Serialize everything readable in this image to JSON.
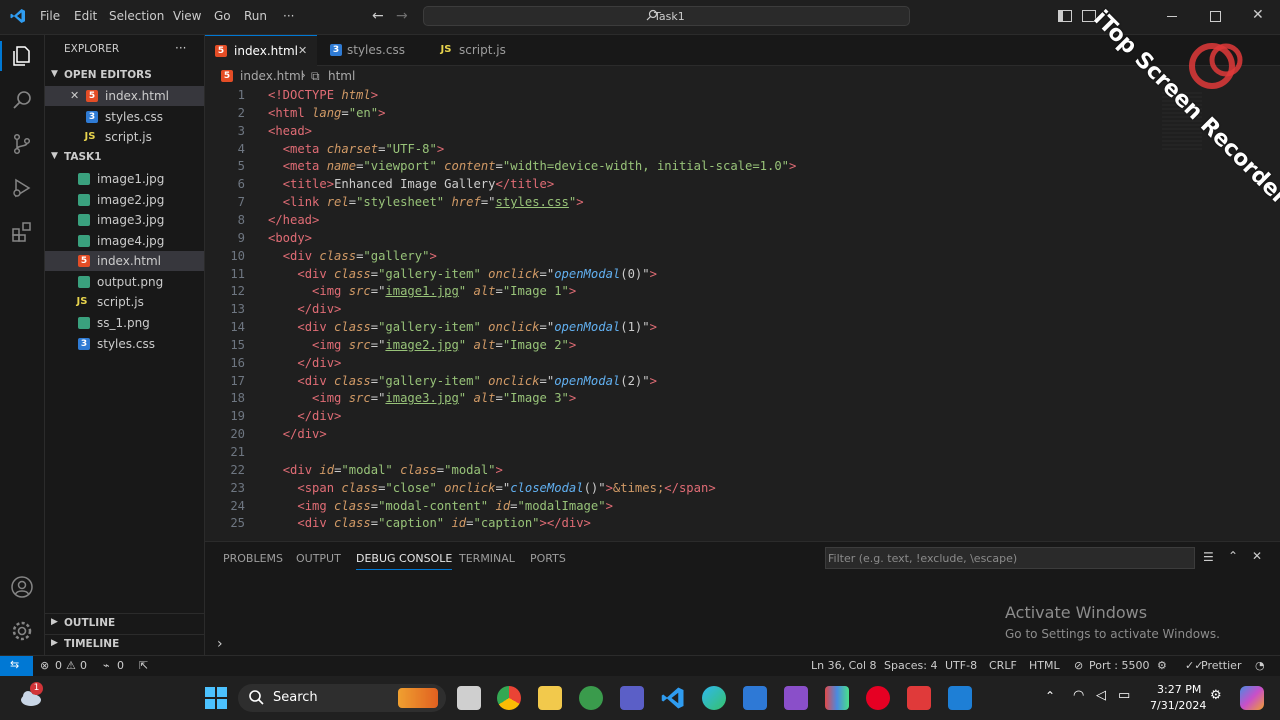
{
  "menu": [
    "File",
    "Edit",
    "Selection",
    "View",
    "Go",
    "Run",
    "···"
  ],
  "search": {
    "text": "Task1"
  },
  "sidebar": {
    "title": "EXPLORER",
    "more": "···",
    "open_editors_label": "OPEN EDITORS",
    "open_editors": [
      {
        "name": "index.html",
        "type": "html",
        "close": "✕"
      },
      {
        "name": "styles.css",
        "type": "css"
      },
      {
        "name": "script.js",
        "type": "js"
      }
    ],
    "folder_label": "TASK1",
    "files": [
      {
        "name": "image1.jpg",
        "type": "img"
      },
      {
        "name": "image2.jpg",
        "type": "img"
      },
      {
        "name": "image3.jpg",
        "type": "img"
      },
      {
        "name": "image4.jpg",
        "type": "img"
      },
      {
        "name": "index.html",
        "type": "html"
      },
      {
        "name": "output.png",
        "type": "img"
      },
      {
        "name": "script.js",
        "type": "js"
      },
      {
        "name": "ss_1.png",
        "type": "img"
      },
      {
        "name": "styles.css",
        "type": "css"
      }
    ],
    "outline_label": "OUTLINE",
    "timeline_label": "TIMELINE"
  },
  "tabs": [
    {
      "name": "index.html",
      "type": "html",
      "close": "✕"
    },
    {
      "name": "styles.css",
      "type": "css"
    },
    {
      "name": "script.js",
      "type": "js"
    }
  ],
  "breadcrumb": {
    "file": "index.html",
    "symbol": "html"
  },
  "code_lines": [
    {
      "n": "1",
      "t": [
        [
          "t-tag",
          "<!DOCTYPE "
        ],
        [
          "t-attr",
          "html"
        ],
        [
          "t-tag",
          ">"
        ]
      ]
    },
    {
      "n": "2",
      "t": [
        [
          "t-tag",
          "<html "
        ],
        [
          "t-attr",
          "lang"
        ],
        [
          "t-punct",
          "="
        ],
        [
          "t-str",
          "\"en\""
        ],
        [
          "t-tag",
          ">"
        ]
      ]
    },
    {
      "n": "3",
      "t": [
        [
          "t-tag",
          "<head>"
        ]
      ]
    },
    {
      "n": "4",
      "t": [
        [
          "t-punct",
          "  "
        ],
        [
          "t-tag",
          "<meta "
        ],
        [
          "t-attr",
          "charset"
        ],
        [
          "t-punct",
          "="
        ],
        [
          "t-str",
          "\"UTF-8\""
        ],
        [
          "t-tag",
          ">"
        ]
      ]
    },
    {
      "n": "5",
      "t": [
        [
          "t-punct",
          "  "
        ],
        [
          "t-tag",
          "<meta "
        ],
        [
          "t-attr",
          "name"
        ],
        [
          "t-punct",
          "="
        ],
        [
          "t-str",
          "\"viewport\" "
        ],
        [
          "t-attr",
          "content"
        ],
        [
          "t-punct",
          "="
        ],
        [
          "t-str",
          "\"width=device-width, initial-scale=1.0\""
        ],
        [
          "t-tag",
          ">"
        ]
      ]
    },
    {
      "n": "6",
      "t": [
        [
          "t-punct",
          "  "
        ],
        [
          "t-tag",
          "<title>"
        ],
        [
          "t-punct",
          "Enhanced Image Gallery"
        ],
        [
          "t-tag",
          "</title>"
        ]
      ]
    },
    {
      "n": "7",
      "t": [
        [
          "t-punct",
          "  "
        ],
        [
          "t-tag",
          "<link "
        ],
        [
          "t-attr",
          "rel"
        ],
        [
          "t-punct",
          "="
        ],
        [
          "t-str",
          "\"stylesheet\" "
        ],
        [
          "t-attr",
          "href"
        ],
        [
          "t-punct",
          "=\""
        ],
        [
          "t-link",
          "styles.css"
        ],
        [
          "t-str",
          "\""
        ],
        [
          "t-tag",
          ">"
        ]
      ]
    },
    {
      "n": "8",
      "t": [
        [
          "t-tag",
          "</head>"
        ]
      ]
    },
    {
      "n": "9",
      "t": [
        [
          "t-tag",
          "<body>"
        ]
      ]
    },
    {
      "n": "10",
      "t": [
        [
          "t-punct",
          "  "
        ],
        [
          "t-tag",
          "<div "
        ],
        [
          "t-attr",
          "class"
        ],
        [
          "t-punct",
          "="
        ],
        [
          "t-str",
          "\"gallery\""
        ],
        [
          "t-tag",
          ">"
        ]
      ]
    },
    {
      "n": "11",
      "t": [
        [
          "t-punct",
          "    "
        ],
        [
          "t-tag",
          "<div "
        ],
        [
          "t-attr",
          "class"
        ],
        [
          "t-punct",
          "="
        ],
        [
          "t-str",
          "\"gallery-item\" "
        ],
        [
          "t-attr",
          "onclick"
        ],
        [
          "t-punct",
          "=\""
        ],
        [
          "t-fn",
          "openModal"
        ],
        [
          "t-punct",
          "(0)\""
        ],
        [
          "t-tag",
          ">"
        ]
      ]
    },
    {
      "n": "12",
      "t": [
        [
          "t-punct",
          "      "
        ],
        [
          "t-tag",
          "<img "
        ],
        [
          "t-attr",
          "src"
        ],
        [
          "t-punct",
          "=\""
        ],
        [
          "t-link",
          "image1.jpg"
        ],
        [
          "t-str",
          "\" "
        ],
        [
          "t-attr",
          "alt"
        ],
        [
          "t-punct",
          "="
        ],
        [
          "t-str",
          "\"Image 1\""
        ],
        [
          "t-tag",
          ">"
        ]
      ]
    },
    {
      "n": "13",
      "t": [
        [
          "t-punct",
          "    "
        ],
        [
          "t-tag",
          "</div>"
        ]
      ]
    },
    {
      "n": "14",
      "t": [
        [
          "t-punct",
          "    "
        ],
        [
          "t-tag",
          "<div "
        ],
        [
          "t-attr",
          "class"
        ],
        [
          "t-punct",
          "="
        ],
        [
          "t-str",
          "\"gallery-item\" "
        ],
        [
          "t-attr",
          "onclick"
        ],
        [
          "t-punct",
          "=\""
        ],
        [
          "t-fn",
          "openModal"
        ],
        [
          "t-punct",
          "(1)\""
        ],
        [
          "t-tag",
          ">"
        ]
      ]
    },
    {
      "n": "15",
      "t": [
        [
          "t-punct",
          "      "
        ],
        [
          "t-tag",
          "<img "
        ],
        [
          "t-attr",
          "src"
        ],
        [
          "t-punct",
          "=\""
        ],
        [
          "t-link",
          "image2.jpg"
        ],
        [
          "t-str",
          "\" "
        ],
        [
          "t-attr",
          "alt"
        ],
        [
          "t-punct",
          "="
        ],
        [
          "t-str",
          "\"Image 2\""
        ],
        [
          "t-tag",
          ">"
        ]
      ]
    },
    {
      "n": "16",
      "t": [
        [
          "t-punct",
          "    "
        ],
        [
          "t-tag",
          "</div>"
        ]
      ]
    },
    {
      "n": "17",
      "t": [
        [
          "t-punct",
          "    "
        ],
        [
          "t-tag",
          "<div "
        ],
        [
          "t-attr",
          "class"
        ],
        [
          "t-punct",
          "="
        ],
        [
          "t-str",
          "\"gallery-item\" "
        ],
        [
          "t-attr",
          "onclick"
        ],
        [
          "t-punct",
          "=\""
        ],
        [
          "t-fn",
          "openModal"
        ],
        [
          "t-punct",
          "(2)\""
        ],
        [
          "t-tag",
          ">"
        ]
      ]
    },
    {
      "n": "18",
      "t": [
        [
          "t-punct",
          "      "
        ],
        [
          "t-tag",
          "<img "
        ],
        [
          "t-attr",
          "src"
        ],
        [
          "t-punct",
          "=\""
        ],
        [
          "t-link",
          "image3.jpg"
        ],
        [
          "t-str",
          "\" "
        ],
        [
          "t-attr",
          "alt"
        ],
        [
          "t-punct",
          "="
        ],
        [
          "t-str",
          "\"Image 3\""
        ],
        [
          "t-tag",
          ">"
        ]
      ]
    },
    {
      "n": "19",
      "t": [
        [
          "t-punct",
          "    "
        ],
        [
          "t-tag",
          "</div>"
        ]
      ]
    },
    {
      "n": "20",
      "t": [
        [
          "t-punct",
          "  "
        ],
        [
          "t-tag",
          "</div>"
        ]
      ]
    },
    {
      "n": "21",
      "t": []
    },
    {
      "n": "22",
      "t": [
        [
          "t-punct",
          "  "
        ],
        [
          "t-tag",
          "<div "
        ],
        [
          "t-attr",
          "id"
        ],
        [
          "t-punct",
          "="
        ],
        [
          "t-str",
          "\"modal\" "
        ],
        [
          "t-attr",
          "class"
        ],
        [
          "t-punct",
          "="
        ],
        [
          "t-str",
          "\"modal\""
        ],
        [
          "t-tag",
          ">"
        ]
      ]
    },
    {
      "n": "23",
      "t": [
        [
          "t-punct",
          "    "
        ],
        [
          "t-tag",
          "<span "
        ],
        [
          "t-attr",
          "class"
        ],
        [
          "t-punct",
          "="
        ],
        [
          "t-str",
          "\"close\" "
        ],
        [
          "t-attr",
          "onclick"
        ],
        [
          "t-punct",
          "=\""
        ],
        [
          "t-fn",
          "closeModal"
        ],
        [
          "t-punct",
          "()\""
        ],
        [
          "t-tag",
          ">"
        ],
        [
          "t-ent",
          "&times;"
        ],
        [
          "t-tag",
          "</span>"
        ]
      ]
    },
    {
      "n": "24",
      "t": [
        [
          "t-punct",
          "    "
        ],
        [
          "t-tag",
          "<img "
        ],
        [
          "t-attr",
          "class"
        ],
        [
          "t-punct",
          "="
        ],
        [
          "t-str",
          "\"modal-content\" "
        ],
        [
          "t-attr",
          "id"
        ],
        [
          "t-punct",
          "="
        ],
        [
          "t-str",
          "\"modalImage\""
        ],
        [
          "t-tag",
          ">"
        ]
      ]
    },
    {
      "n": "25",
      "t": [
        [
          "t-punct",
          "    "
        ],
        [
          "t-tag",
          "<div "
        ],
        [
          "t-attr",
          "class"
        ],
        [
          "t-punct",
          "="
        ],
        [
          "t-str",
          "\"caption\" "
        ],
        [
          "t-attr",
          "id"
        ],
        [
          "t-punct",
          "="
        ],
        [
          "t-str",
          "\"caption\""
        ],
        [
          "t-tag",
          "></div>"
        ]
      ]
    }
  ],
  "panel": {
    "tabs": [
      "PROBLEMS",
      "OUTPUT",
      "DEBUG CONSOLE",
      "TERMINAL",
      "PORTS"
    ],
    "active_tab": "DEBUG CONSOLE",
    "filter_placeholder": "Filter (e.g. text, !exclude, \\escape)",
    "prompt": "›"
  },
  "status": {
    "errors": "0",
    "warnings": "0",
    "ports_fwd": "0",
    "position": "Ln 36, Col 8",
    "spaces": "Spaces: 4",
    "encoding": "UTF-8",
    "eol": "CRLF",
    "language": "HTML",
    "port": "Port : 5500",
    "prettier": "Prettier"
  },
  "watermark": {
    "text": "iTop Screen Recorder",
    "activate_title": "Activate Windows",
    "activate_sub": "Go to Settings to activate Windows."
  },
  "taskbar": {
    "search_label": "Search",
    "time": "3:27 PM",
    "date": "7/31/2024",
    "badge": "1"
  },
  "colors": {
    "accent": "#0078d4",
    "html": "#e44d26",
    "css": "#2f7bd4",
    "js": "#e8d44d"
  }
}
